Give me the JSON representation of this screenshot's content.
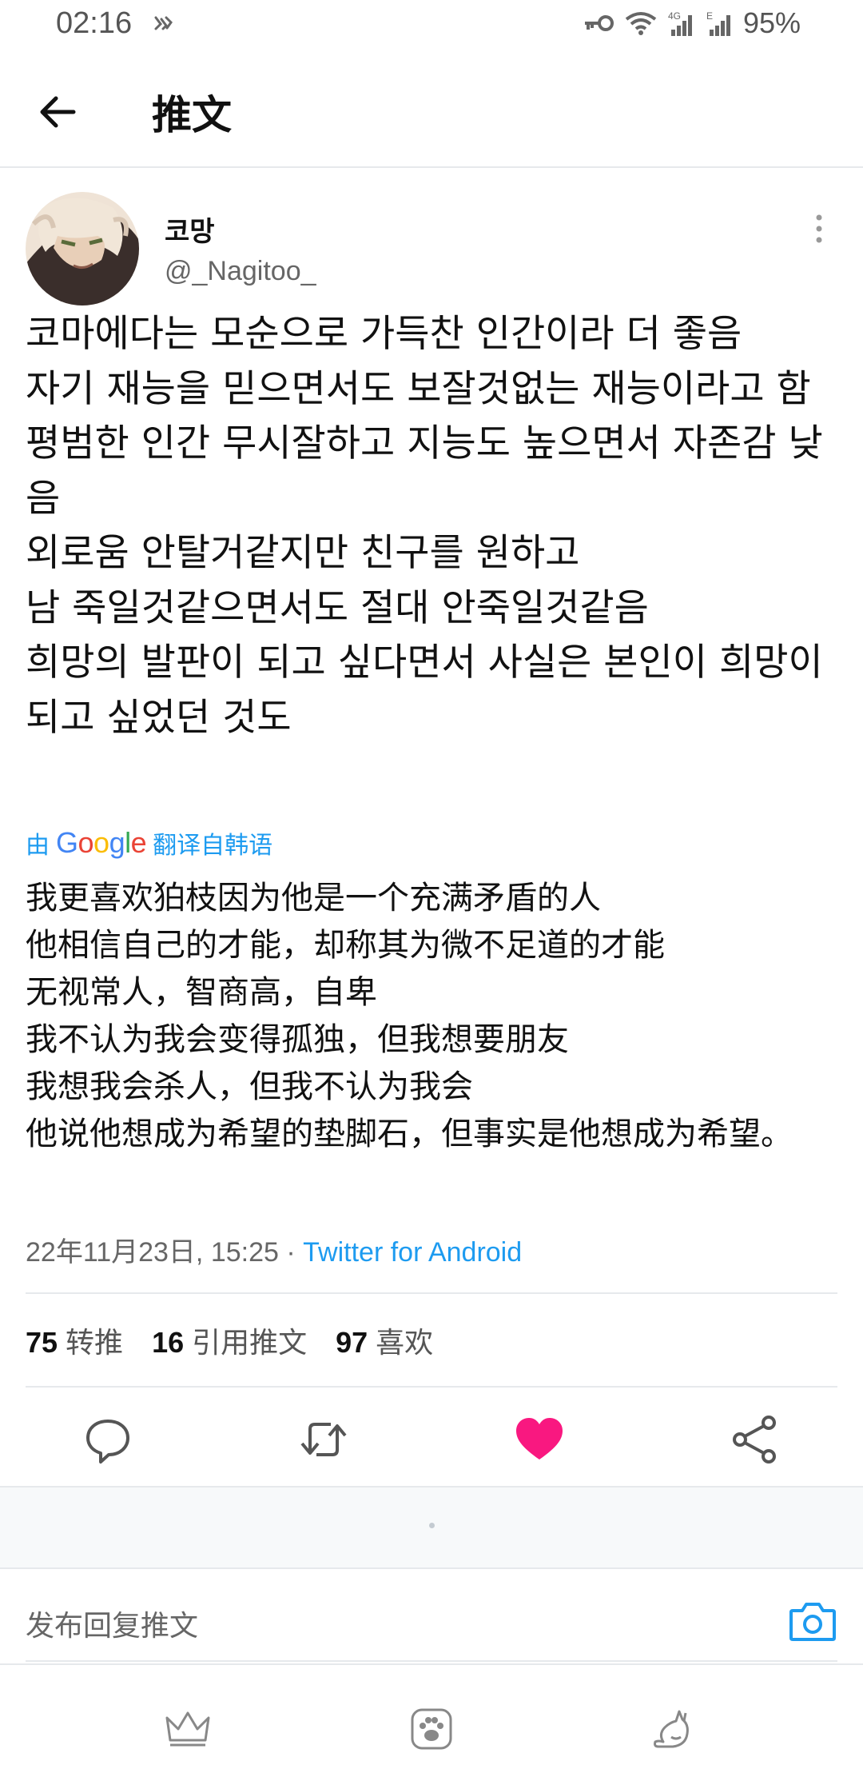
{
  "status_bar": {
    "time": "02:16",
    "battery": "95%",
    "icons": [
      "key-icon",
      "wifi-icon",
      "signal-4g-icon",
      "signal-e-icon"
    ]
  },
  "header": {
    "title": "推文",
    "back_icon": "arrow-left-icon"
  },
  "tweet": {
    "author_name": "코망",
    "author_handle": "@_Nagitoo_",
    "original_text": "코마에다는 모순으로 가득찬 인간이라 더 좋음\n자기 재능을 믿으면서도 보잘것없는 재능이라고 함\n평범한 인간 무시잘하고 지능도 높으면서 자존감 낮음\n외로움 안탈거같지만 친구를 원하고\n남 죽일것같으면서도 절대 안죽일것같음\n희망의 발판이 되고 싶다면서 사실은 본인이 희망이 되고 싶었던 것도",
    "translate_prefix": "由",
    "translate_brand": "Google",
    "translate_suffix": "翻译自韩语",
    "translated_text": "我更喜欢狛枝因为他是一个充满矛盾的人\n他相信自己的才能，却称其为微不足道的才能\n无视常人，智商高，自卑\n我不认为我会变得孤独，但我想要朋友\n我想我会杀人，但我不认为我会\n他说他想成为希望的垫脚石，但事实是他想成为希望。",
    "timestamp": "22年11月23日, 15:25",
    "separator": " · ",
    "source": "Twitter for Android"
  },
  "stats": [
    {
      "count": "75",
      "label": "转推"
    },
    {
      "count": "16",
      "label": "引用推文"
    },
    {
      "count": "97",
      "label": "喜欢"
    }
  ],
  "actions": {
    "reply_icon": "comment-icon",
    "retweet_icon": "retweet-icon",
    "like_icon": "heart-icon",
    "share_icon": "share-icon",
    "like_color": "#f91880"
  },
  "reply_box": {
    "placeholder": "发布回复推文",
    "camera_icon": "camera-icon"
  },
  "bottom_nav": {
    "icons": [
      "crown-icon",
      "paw-icon",
      "cat-icon"
    ]
  },
  "colors": {
    "accent": "#1d9bf0",
    "like": "#f91880"
  }
}
